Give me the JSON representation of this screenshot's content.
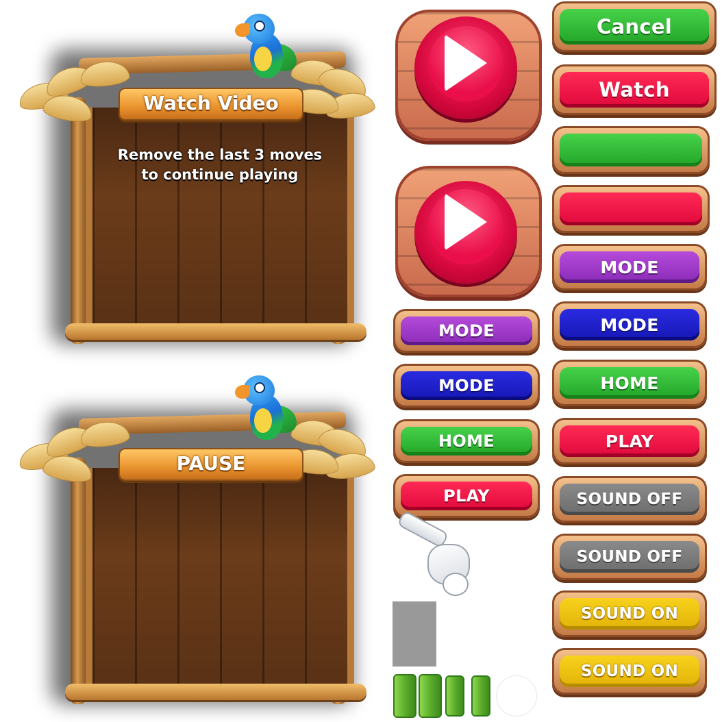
{
  "watch_panel": {
    "title": "Watch Video",
    "message_line1": "Remove the last 3 moves",
    "message_line2": "to continue playing"
  },
  "pause_panel": {
    "title": "PAUSE"
  },
  "round_buttons": [
    {
      "icon": "play-icon",
      "color": "#ea0f4a"
    },
    {
      "icon": "play-icon",
      "color": "#ea0f4a"
    }
  ],
  "right_buttons": {
    "cancel": "Cancel",
    "watch": "Watch",
    "blank_green": "",
    "blank_red": "",
    "mode_purple": "MODE",
    "mode_blue": "MODE",
    "home": "HOME",
    "play": "PLAY",
    "sound_off_1": "SOUND OFF",
    "sound_off_2": "SOUND OFF",
    "sound_on_1": "SOUND ON",
    "sound_on_2": "SOUND ON"
  },
  "left_buttons": {
    "mode_purple": "MODE",
    "mode_blue": "MODE",
    "home": "HOME",
    "play": "PLAY"
  },
  "colors": {
    "green": "#22a428",
    "red": "#e0083c",
    "purple": "#8a2bb8",
    "blue": "#1617b4",
    "gray": "#6c6c6c",
    "yellow": "#e2b208",
    "wood": "#6b3c1a"
  }
}
